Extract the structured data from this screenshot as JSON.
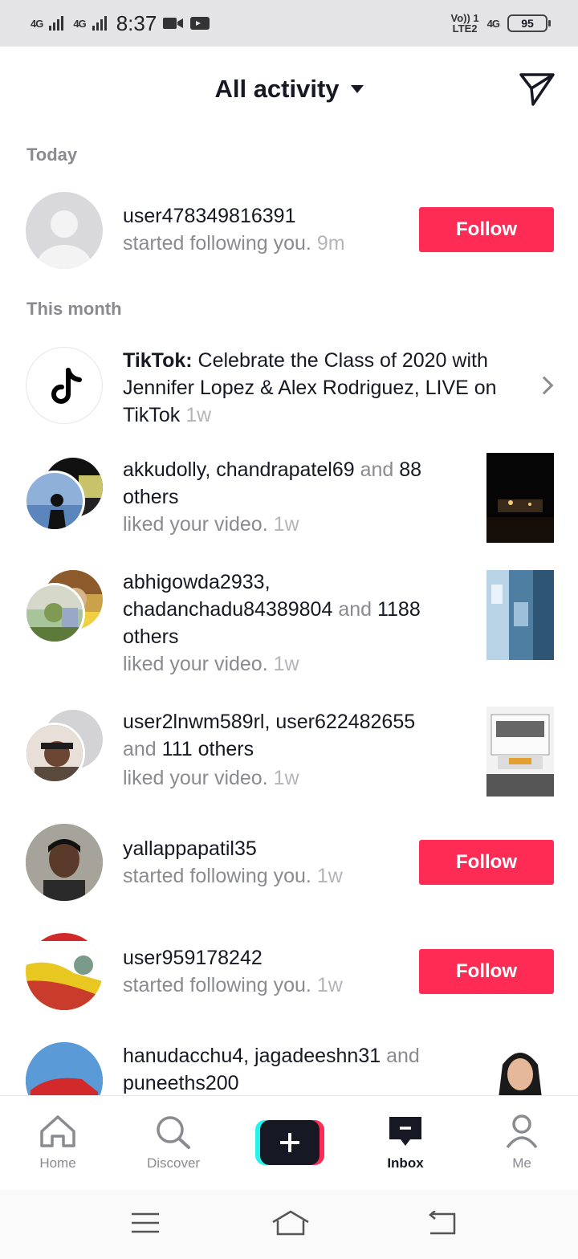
{
  "status": {
    "signal1": "4G",
    "signal2": "4G",
    "time": "8:37",
    "volte_top": "Vo)) 1",
    "volte_bottom": "LTE2",
    "net": "4G",
    "battery": "95"
  },
  "header": {
    "title": "All activity"
  },
  "sections": {
    "today": "Today",
    "month": "This month"
  },
  "items": [
    {
      "user": "user478349816391",
      "action": "started following you.",
      "time": "9m",
      "button": "Follow"
    },
    {
      "user": "TikTok:",
      "rest": "Celebrate the Class of 2020 with Jennifer Lopez & Alex Rodriguez, LIVE on TikTok",
      "time": "1w"
    },
    {
      "user": "akkudolly",
      "sep": ", ",
      "user2": "chandrapatel69",
      "and": " and ",
      "count": "88",
      "others": "others",
      "action": "liked your video.",
      "time": "1w"
    },
    {
      "user": "abhigowda2933",
      "sep": ",",
      "user2": "chadanchadu84389804",
      "and": " and ",
      "count": "1188",
      "others": "others",
      "action": "liked your video.",
      "time": "1w"
    },
    {
      "user": "user2lnwm589rl",
      "sep": ", ",
      "user2": "user622482655",
      "and": "and ",
      "count": "111",
      "others": " others",
      "action": "liked your video.",
      "time": "1w"
    },
    {
      "user": "yallappapatil35",
      "action": "started following you.",
      "time": "1w",
      "button": "Follow"
    },
    {
      "user": "user959178242",
      "action": "started following you.",
      "time": "1w",
      "button": "Follow"
    },
    {
      "user": "hanudacchu4",
      "sep": ", ",
      "user2": "jagadeeshn31",
      "and": " and",
      "user3": "puneeths200"
    }
  ],
  "tabs": {
    "home": "Home",
    "discover": "Discover",
    "inbox": "Inbox",
    "me": "Me"
  },
  "colors": {
    "accent": "#fe2c55",
    "text": "#161823",
    "muted": "#8a8b91"
  }
}
